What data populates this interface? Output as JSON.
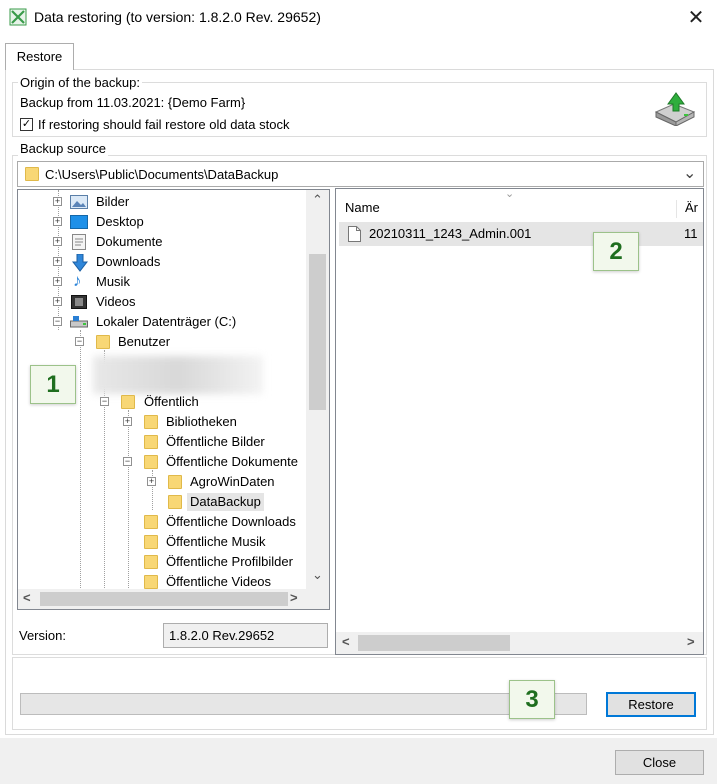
{
  "window": {
    "title": "Data restoring (to version: 1.8.2.0 Rev. 29652)",
    "close_glyph": "✕"
  },
  "tabs": [
    {
      "label": "Restore"
    }
  ],
  "origin": {
    "legend": "Origin of the backup:",
    "backup_from": "Backup from 11.03.2021: {Demo Farm}",
    "checkbox_label": "If restoring should fail restore old data stock",
    "checkbox_checked": true,
    "checkmark": "✓",
    "icon": "restore-drive-icon"
  },
  "source": {
    "legend": "Backup source",
    "path": "C:\\Users\\Public\\Documents\\DataBackup",
    "dropdown_glyph": "⌄"
  },
  "tree": {
    "items": [
      {
        "label": "Bilder",
        "icon": "pictures-icon"
      },
      {
        "label": "Desktop",
        "icon": "desktop-icon"
      },
      {
        "label": "Dokumente",
        "icon": "documents-icon"
      },
      {
        "label": "Downloads",
        "icon": "downloads-icon"
      },
      {
        "label": "Musik",
        "icon": "music-icon"
      },
      {
        "label": "Videos",
        "icon": "videos-icon"
      },
      {
        "label": "Lokaler Datenträger (C:)",
        "icon": "drive-icon"
      },
      {
        "label": "Benutzer",
        "icon": "folder-icon"
      },
      {
        "label": "Öffentlich",
        "icon": "folder-icon"
      },
      {
        "label": "Bibliotheken",
        "icon": "folder-icon"
      },
      {
        "label": "Öffentliche Bilder",
        "icon": "folder-icon"
      },
      {
        "label": "Öffentliche Dokumente",
        "icon": "folder-icon"
      },
      {
        "label": "AgroWinDaten",
        "icon": "folder-icon"
      },
      {
        "label": "DataBackup",
        "icon": "folder-icon",
        "selected": true
      },
      {
        "label": "Öffentliche Downloads",
        "icon": "folder-icon"
      },
      {
        "label": "Öffentliche Musik",
        "icon": "folder-icon"
      },
      {
        "label": "Öffentliche Profilbilder",
        "icon": "folder-icon"
      },
      {
        "label": "Öffentliche Videos",
        "icon": "folder-icon"
      }
    ],
    "expand_plus": "+",
    "expand_minus": "−",
    "scroll_up": "⌃",
    "scroll_down": "⌄",
    "scroll_left": "<",
    "scroll_right": ">"
  },
  "version": {
    "label": "Version:",
    "value": "1.8.2.0 Rev.29652"
  },
  "file_list": {
    "columns": [
      "Name",
      "Är"
    ],
    "rows": [
      {
        "name": "20210311_1243_Admin.001",
        "col2": "11"
      }
    ],
    "scroll_left": "<",
    "scroll_right": ">"
  },
  "badges": [
    "1",
    "2",
    "3"
  ],
  "progress": {
    "value": 0
  },
  "buttons": {
    "restore": "Restore",
    "close": "Close"
  },
  "colors": {
    "accent": "#0078d7",
    "selection": "#cce8ff",
    "badge_green": "#1f6e1f",
    "app_icon": "#3a9b4a"
  }
}
